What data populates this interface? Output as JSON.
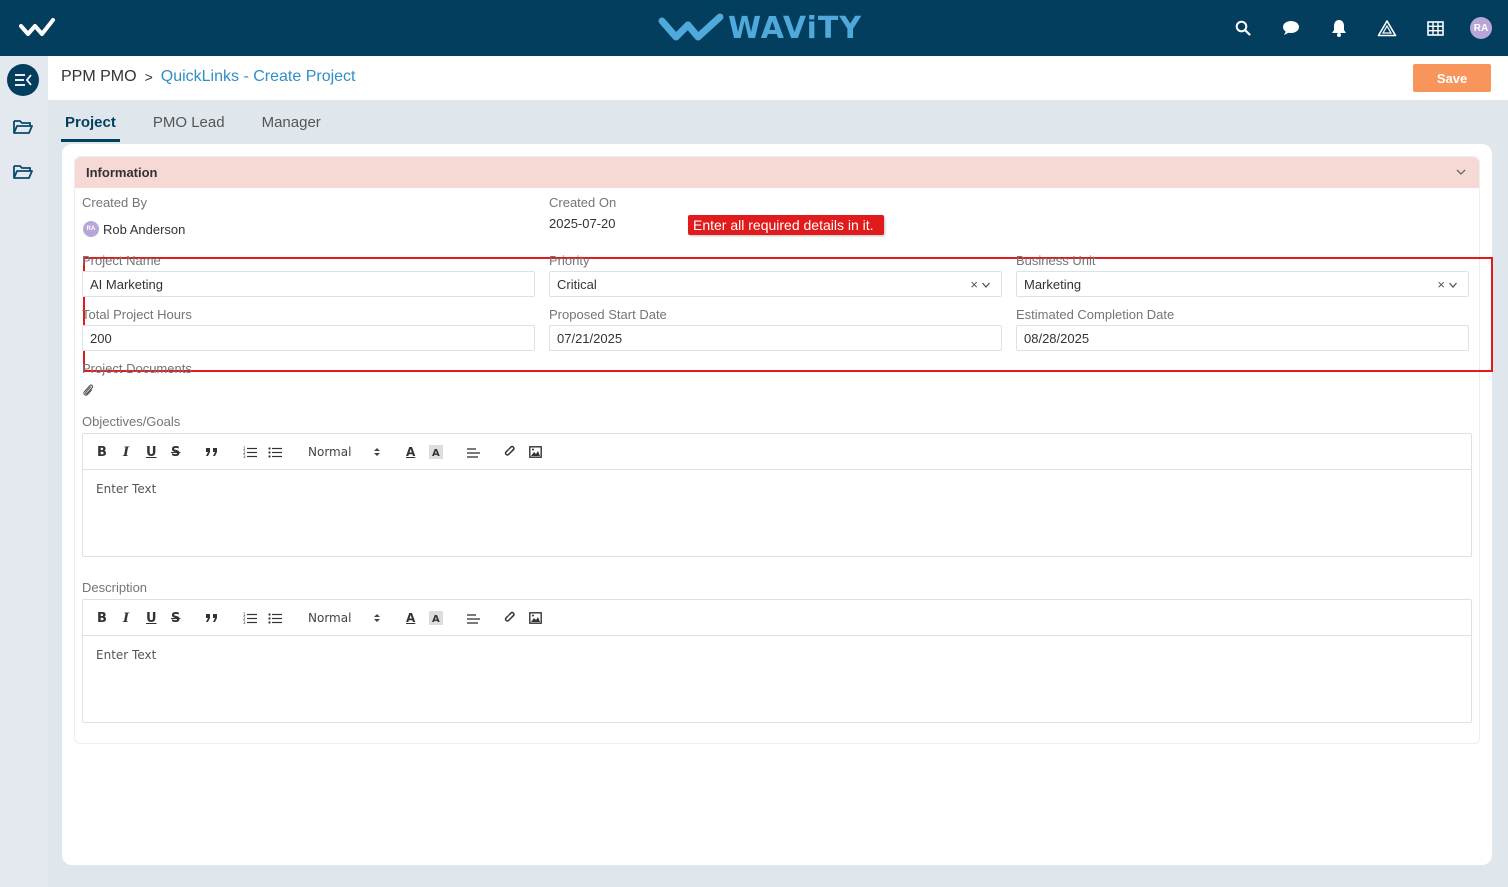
{
  "app": {
    "brand_name": "WAViTY",
    "user_initials": "RA"
  },
  "colors": {
    "topbar": "#033e5e",
    "accent": "#2f8fc7",
    "save_button": "#f7955a",
    "section_header": "#f6d8d4",
    "callout": "#e11b1b"
  },
  "breadcrumb": {
    "root": "PPM PMO",
    "separator": ">",
    "current": "QuickLinks - Create Project"
  },
  "toolbar": {
    "save_label": "Save"
  },
  "tabs": [
    {
      "label": "Project",
      "active": true
    },
    {
      "label": "PMO Lead",
      "active": false
    },
    {
      "label": "Manager",
      "active": false
    }
  ],
  "section": {
    "title": "Information"
  },
  "meta": {
    "created_by_label": "Created By",
    "created_by_initials": "RA",
    "created_by_name": "Rob Anderson",
    "created_on_label": "Created On",
    "created_on_value": "2025-07-20"
  },
  "callout": {
    "text": "Enter all required details in it."
  },
  "fields": {
    "project_name": {
      "label": "Project Name",
      "value": "AI Marketing"
    },
    "priority": {
      "label": "Priority",
      "value": "Critical"
    },
    "business_unit": {
      "label": "Business Unit",
      "value": "Marketing"
    },
    "total_hours": {
      "label": "Total Project Hours",
      "value": "200"
    },
    "start_date": {
      "label": "Proposed Start Date",
      "value": "07/21/2025"
    },
    "completion_date": {
      "label": "Estimated Completion Date",
      "value": "08/28/2025"
    },
    "documents": {
      "label": "Project Documents"
    }
  },
  "editors": {
    "objectives": {
      "label": "Objectives/Goals",
      "format": "Normal",
      "placeholder": "Enter Text"
    },
    "description": {
      "label": "Description",
      "format": "Normal",
      "placeholder": "Enter Text"
    }
  },
  "editor_buttons": {
    "bold": "B",
    "italic": "I",
    "underline": "U",
    "strike": "S",
    "font_color": "A"
  },
  "icons": {
    "top": [
      "search-icon",
      "chat-icon",
      "bell-icon",
      "alert-triangle-icon",
      "grid-icon"
    ],
    "sidebar": [
      "menu-collapse-icon",
      "folder-icon",
      "folder-icon"
    ]
  }
}
